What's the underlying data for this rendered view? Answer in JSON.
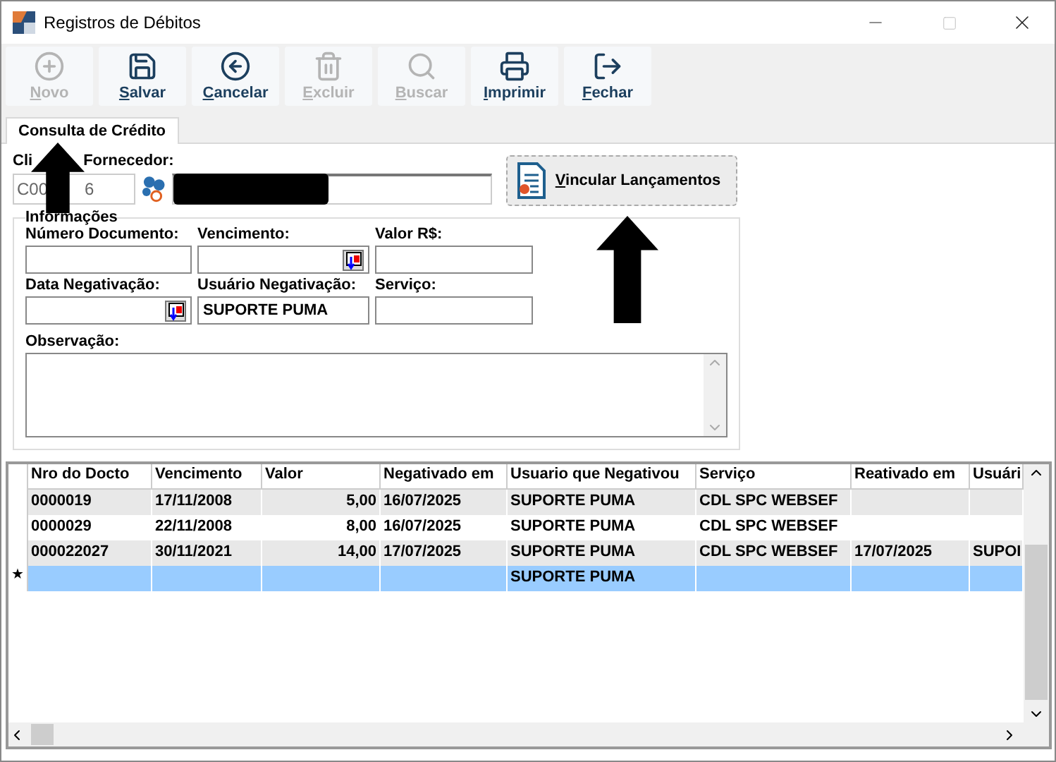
{
  "window": {
    "title": "Registros de Débitos"
  },
  "toolbar": [
    {
      "label": "Novo",
      "kind": "add",
      "disabled": true
    },
    {
      "label": "Salvar",
      "kind": "save",
      "disabled": false
    },
    {
      "label": "Cancelar",
      "kind": "cancel",
      "disabled": false
    },
    {
      "label": "Excluir",
      "kind": "delete",
      "disabled": true
    },
    {
      "label": "Buscar",
      "kind": "search",
      "disabled": true
    },
    {
      "label": "Imprimir",
      "kind": "print",
      "disabled": false
    },
    {
      "label": "Fechar",
      "kind": "exit",
      "disabled": false
    }
  ],
  "tabs": [
    {
      "label": "Consulta de Crédito",
      "selected": true
    }
  ],
  "client": {
    "label_parts": [
      "Cli",
      "Fornecedor:"
    ],
    "code_parts": [
      "C00",
      "6"
    ],
    "link_button": "Vincular Lançamentos"
  },
  "info": {
    "title": "Informações",
    "fields": [
      {
        "label": "Número Documento:",
        "kind": "text"
      },
      {
        "label": "Vencimento:",
        "kind": "date"
      },
      {
        "label": "Valor R$:",
        "kind": "text"
      },
      {
        "label": "Data Negativação:",
        "kind": "date"
      },
      {
        "label": "Usuário Negativação:",
        "value": "SUPORTE PUMA",
        "kind": "text"
      },
      {
        "label": "Serviço:",
        "kind": "text"
      }
    ],
    "notes_label": "Observação:"
  },
  "table": {
    "columns": [
      "Nro do Docto",
      "Vencimento",
      "Valor",
      "Negativado em",
      "Usuario que Negativou",
      "Serviço",
      "Reativado em",
      "Usuári"
    ],
    "rows": [
      {
        "selected": false,
        "cells": [
          "0000019",
          "17/11/2008",
          "5,00",
          "16/07/2025",
          "SUPORTE PUMA",
          "CDL SPC WEBSEF",
          null,
          null
        ]
      },
      {
        "selected": false,
        "cells": [
          "0000029",
          "22/11/2008",
          "8,00",
          "16/07/2025",
          "SUPORTE PUMA",
          "CDL SPC WEBSEF",
          null,
          null
        ]
      },
      {
        "selected": false,
        "cells": [
          "000022027",
          "30/11/2021",
          "14,00",
          "17/07/2025",
          "SUPORTE PUMA",
          "CDL SPC WEBSEF",
          "17/07/2025",
          "SUPOI"
        ]
      },
      {
        "marker": "★",
        "selected": true,
        "cells": [
          null,
          null,
          null,
          null,
          "SUPORTE PUMA",
          null,
          null,
          null
        ]
      }
    ]
  }
}
